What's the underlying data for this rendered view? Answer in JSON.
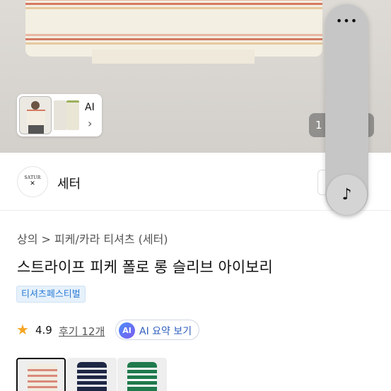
{
  "gallery": {
    "thumb_label": "AI",
    "thumb_chevron": "›",
    "counter": "1"
  },
  "side_panel": {
    "more_icon": "•••",
    "music_icon": "♪"
  },
  "brand": {
    "logo_text": "SATUR",
    "logo_symbol": "✕",
    "name": "세터"
  },
  "product": {
    "breadcrumb": "상의 > 피케/카라 티셔츠 (세터)",
    "title": "스트라이프 피케 폴로 롱 슬리브 아이보리",
    "tag": "티셔츠페스티벌",
    "rating": "4.9",
    "reviews": "후기 12개",
    "ai_badge": "AI",
    "ai_summary": "AI 요약 보기"
  },
  "color_options": [
    {
      "name": "ivory",
      "body": "#f1ece0",
      "stripe": "#d98a7a",
      "selected": true
    },
    {
      "name": "navy",
      "body": "#1e2744",
      "stripe": "#e9e9f0",
      "selected": false
    },
    {
      "name": "green",
      "body": "#1f7a4c",
      "stripe": "#ffffff",
      "selected": false
    }
  ],
  "colors": {
    "accent_blue": "#2b7bd6",
    "star": "#f5a623"
  }
}
